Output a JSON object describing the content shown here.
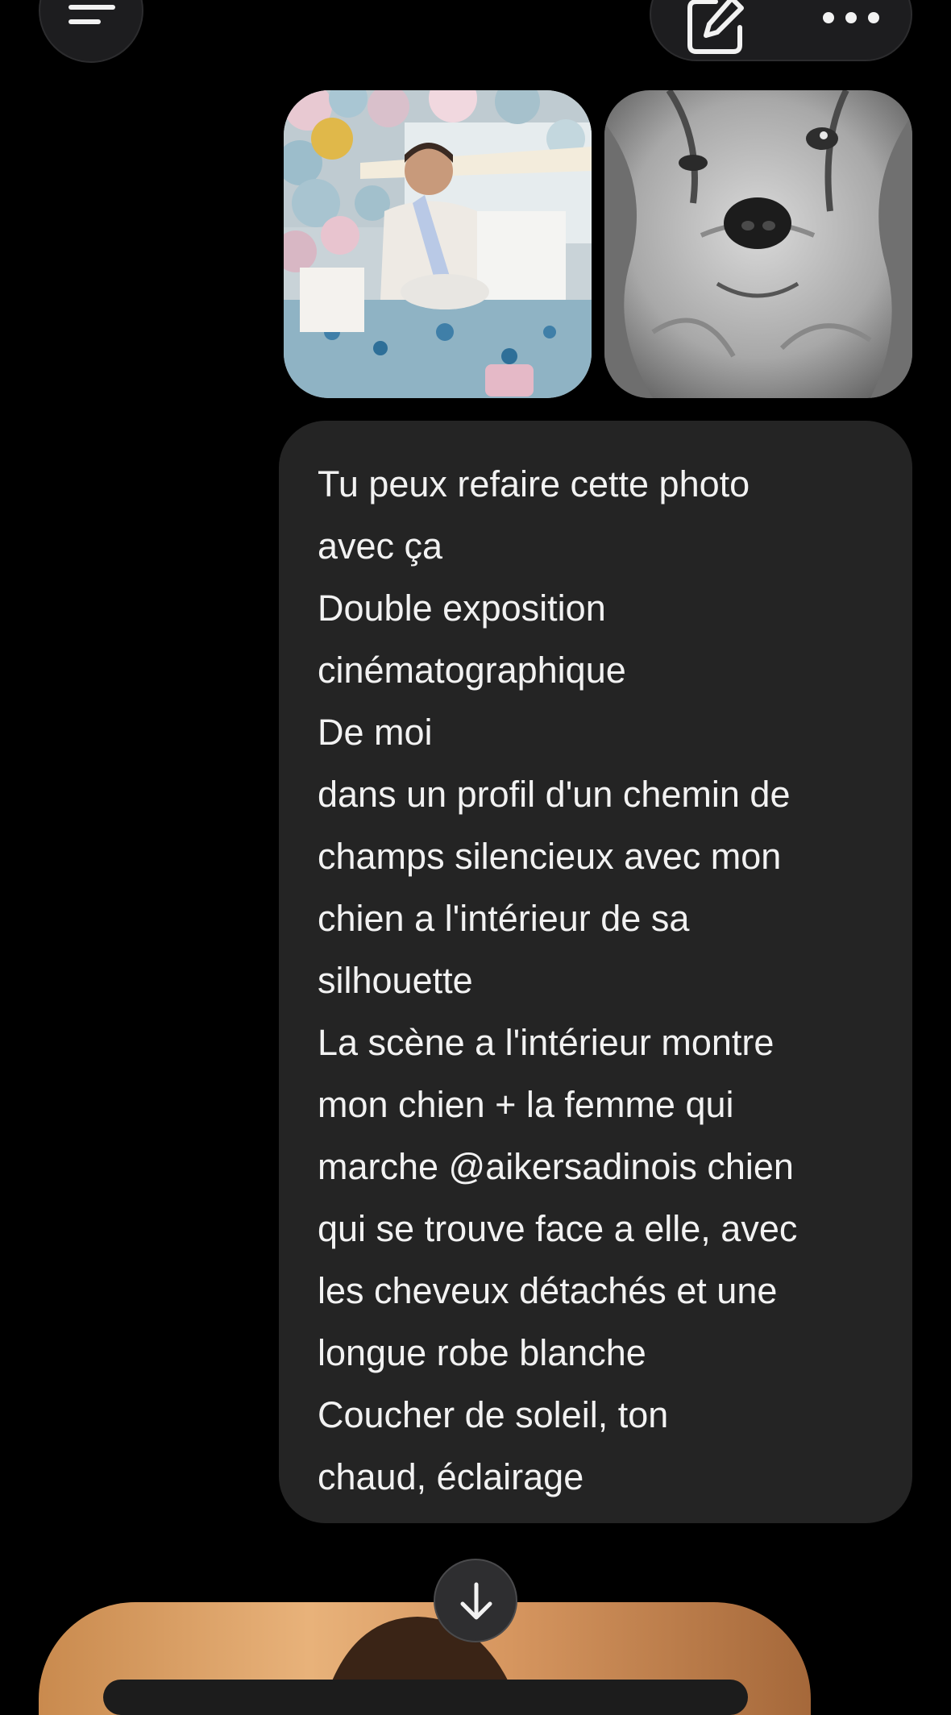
{
  "header": {
    "menu_icon": "hamburger-menu-icon",
    "edit_icon": "new-chat-pencil-icon",
    "more_icon": "more-dots-icon"
  },
  "attachments": [
    {
      "kind": "photo",
      "subject": "baby shower party"
    },
    {
      "kind": "photo",
      "subject": "dog close-up black and white"
    }
  ],
  "message": {
    "lines": [
      "Tu peux refaire cette photo",
      "avec ça",
      "Double exposition",
      "cinématographique",
      "De moi",
      "dans un profil d'un chemin de",
      "champs silencieux avec mon",
      "chien a l'intérieur de sa",
      "silhouette",
      "La scène a l'intérieur montre",
      "mon chien + la femme qui",
      "marche @aikersadinois chien",
      "qui se trouve face a elle, avec",
      "les cheveux détachés et une",
      "longue robe blanche",
      "Coucher de soleil, ton",
      "chaud, éclairage"
    ]
  },
  "scroll_button": {
    "icon": "arrow-down-icon"
  },
  "colors": {
    "background": "#000000",
    "bubble": "#242424",
    "text": "#f2f2f2",
    "control_bg": "#1d1d1f"
  }
}
